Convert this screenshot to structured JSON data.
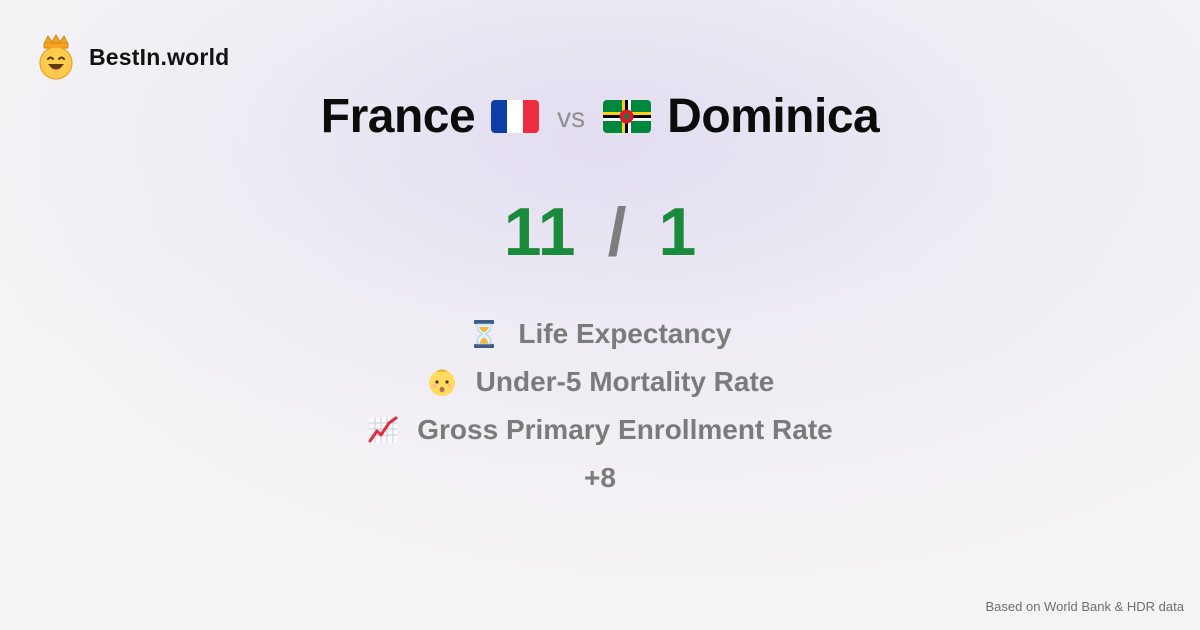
{
  "brand": {
    "name": "BestIn.world",
    "icon": "crowned-smiley-icon"
  },
  "comparison": {
    "country_a": "France",
    "country_b": "Dominica",
    "vs_label": "vs",
    "flag_a_icon": "france-flag-icon",
    "flag_b_icon": "dominica-flag-icon"
  },
  "score": {
    "a": "11",
    "separator": "/",
    "b": "1",
    "color": "#1a8b3a"
  },
  "metrics": [
    {
      "label": "Life Expectancy",
      "icon": "hourglass-icon"
    },
    {
      "label": "Under-5 Mortality Rate",
      "icon": "baby-icon"
    },
    {
      "label": "Gross Primary Enrollment Rate",
      "icon": "chart-increasing-icon"
    }
  ],
  "more_label": "+8",
  "footer": {
    "source": "Based on World Bank & HDR data"
  }
}
